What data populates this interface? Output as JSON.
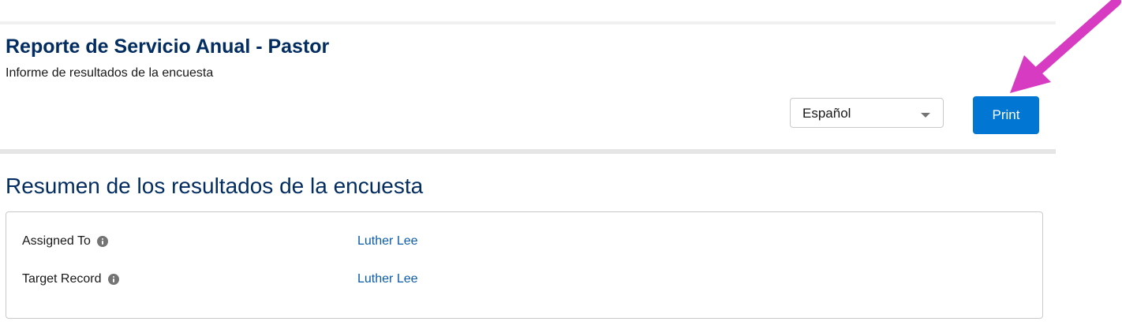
{
  "header": {
    "title": "Reporte de Servicio Anual - Pastor",
    "subtitle": "Informe de resultados de la encuesta"
  },
  "language_select": {
    "value": "Español"
  },
  "print_button": {
    "label": "Print"
  },
  "summary": {
    "title": "Resumen de los resultados de la encuesta",
    "fields": [
      {
        "label": "Assigned To",
        "value": "Luther Lee"
      },
      {
        "label": "Target Record",
        "value": "Luther Lee"
      }
    ]
  },
  "colors": {
    "title": "#032d60",
    "brand": "#0176d3",
    "link": "#0b5cab",
    "annotation_arrow": "#d63bc2"
  },
  "icons": {
    "info": "info-icon",
    "dropdown": "chevron-down-icon"
  }
}
